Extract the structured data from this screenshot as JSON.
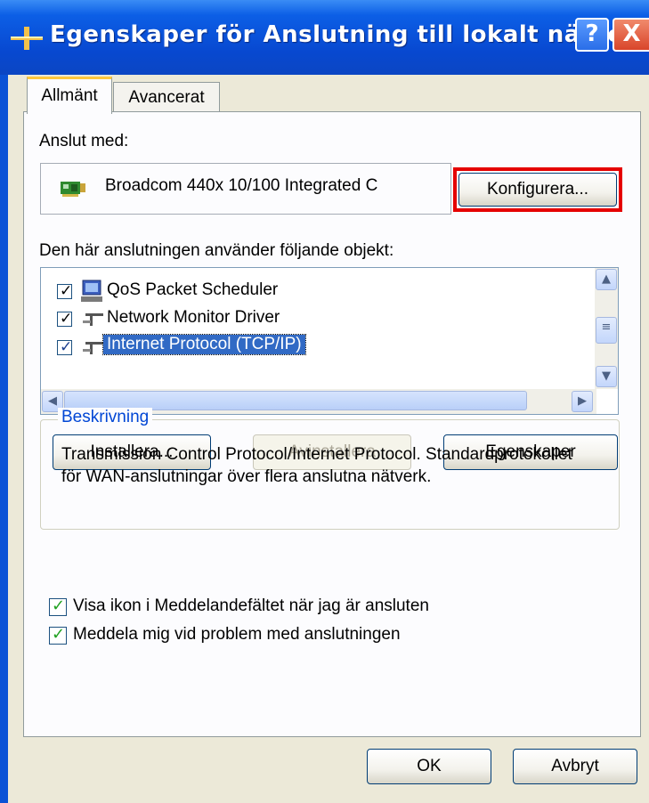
{
  "window": {
    "title": "Egenskaper för Anslutning till lokalt nätverk",
    "help_label": "?",
    "close_label": "X"
  },
  "tabs": [
    {
      "label": "Allmänt",
      "active": true
    },
    {
      "label": "Avancerat",
      "active": false
    }
  ],
  "connect": {
    "label": "Anslut med:",
    "adapter_name": "Broadcom 440x 10/100 Integrated C",
    "configure_label": "Konfigurera..."
  },
  "components": {
    "label": "Den här anslutningen använder följande objekt:",
    "items": [
      {
        "label": "QoS Packet Scheduler",
        "checked": true,
        "selected": false,
        "icon": "scheduler-icon"
      },
      {
        "label": "Network Monitor Driver",
        "checked": true,
        "selected": false,
        "icon": "network-protocol-icon"
      },
      {
        "label": "Internet Protocol (TCP/IP)",
        "checked": true,
        "selected": true,
        "icon": "network-protocol-icon"
      }
    ]
  },
  "buttons": {
    "install": "Installera...",
    "uninstall": "Avinstallera",
    "properties": "Egenskaper",
    "ok": "OK",
    "cancel": "Avbryt"
  },
  "description": {
    "title": "Beskrivning",
    "text": "Transmission Control Protocol/Internet Protocol. Standardprotokollet för WAN-anslutningar över flera anslutna nätverk."
  },
  "options": [
    {
      "label": "Visa ikon i Meddelandefältet när jag är ansluten",
      "checked": true
    },
    {
      "label": "Meddela mig vid problem med anslutningen",
      "checked": true
    }
  ],
  "colors": {
    "titlebar": "#0848d0",
    "highlight_box": "#e50000",
    "selection": "#316ac5"
  }
}
